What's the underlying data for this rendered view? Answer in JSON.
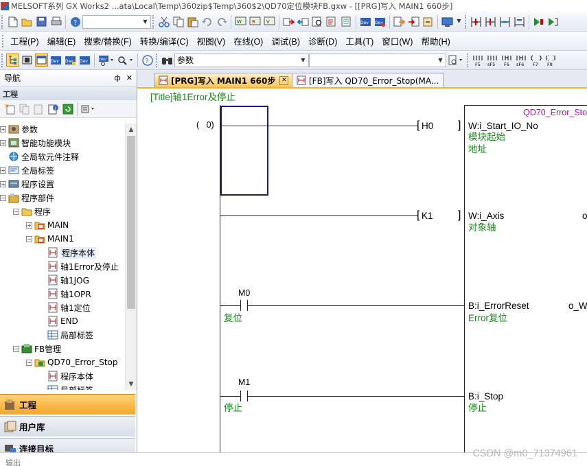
{
  "window": {
    "title": "MELSOFT系列 GX Works2 ...ata\\Local\\Temp\\360zip$Temp\\360$2\\QD70定位模块FB.gxw - [[PRG]写入 MAIN1 660步]"
  },
  "toolbar1": {
    "combo_value": "",
    "buttons": [
      "new-file-icon",
      "open-folder-icon",
      "save-icon",
      "print-icon",
      "help-icon",
      "cut-icon",
      "copy-icon",
      "paste-icon",
      "undo-icon",
      "redo-icon",
      "plc-write-icon",
      "plc-read-icon",
      "verify-icon",
      "monitor-icon",
      "device-test-icon",
      "write-arrow-icon",
      "read-arrow-icon",
      "search-device-icon",
      "cross-ref-icon",
      "device-batch-icon",
      "dev-icon",
      "dev-detail-icon",
      "export-icon",
      "import-icon",
      "link-icon",
      "display-icon",
      "ladder-insert-icon",
      "ladder-insert2-icon",
      "ladder-delete-icon",
      "ladder-delete2-icon",
      "step-run-icon",
      "step-run2-icon"
    ]
  },
  "menu": [
    "工程(P)",
    "编辑(E)",
    "搜索/替换(F)",
    "转换/编译(C)",
    "视图(V)",
    "在线(O)",
    "调试(B)",
    "诊断(D)",
    "工具(T)",
    "窗口(W)",
    "帮助(H)"
  ],
  "toolbar2": {
    "param_combo": "参数",
    "second_combo": "",
    "fkeys": [
      "F5",
      "sF5",
      "F6",
      "sF6",
      "F7",
      "F8"
    ]
  },
  "nav": {
    "title": "导航",
    "pin": "ф",
    "close": "✕",
    "section": "工程",
    "tree": [
      {
        "label": "参数",
        "depth": 0,
        "exp": "+",
        "icon": "param"
      },
      {
        "label": "智能功能模块",
        "depth": 0,
        "exp": "+",
        "icon": "module"
      },
      {
        "label": "全局软元件注释",
        "depth": 0,
        "exp": "",
        "icon": "globe"
      },
      {
        "label": "全局标签",
        "depth": 0,
        "exp": "+",
        "icon": "label"
      },
      {
        "label": "程序设置",
        "depth": 0,
        "exp": "+",
        "icon": "setting"
      },
      {
        "label": "程序部件",
        "depth": 0,
        "exp": "−",
        "icon": "parts"
      },
      {
        "label": "程序",
        "depth": 1,
        "exp": "−",
        "icon": "folder"
      },
      {
        "label": "MAIN",
        "depth": 2,
        "exp": "+",
        "icon": "prog"
      },
      {
        "label": "MAIN1",
        "depth": 2,
        "exp": "−",
        "icon": "prog"
      },
      {
        "label": "程序本体",
        "depth": 3,
        "exp": "",
        "icon": "doc",
        "selected": true
      },
      {
        "label": "轴1Error及停止",
        "depth": 3,
        "exp": "",
        "icon": "doc"
      },
      {
        "label": "轴1JOG",
        "depth": 3,
        "exp": "",
        "icon": "doc"
      },
      {
        "label": "轴1OPR",
        "depth": 3,
        "exp": "",
        "icon": "doc"
      },
      {
        "label": "轴1定位",
        "depth": 3,
        "exp": "",
        "icon": "doc"
      },
      {
        "label": "END",
        "depth": 3,
        "exp": "",
        "icon": "doc"
      },
      {
        "label": "局部标签",
        "depth": 3,
        "exp": "",
        "icon": "table"
      },
      {
        "label": "FB管理",
        "depth": 1,
        "exp": "−",
        "icon": "fb"
      },
      {
        "label": "QD70_Error_Stop",
        "depth": 2,
        "exp": "−",
        "icon": "fbfolder"
      },
      {
        "label": "程序本体",
        "depth": 3,
        "exp": "",
        "icon": "doc"
      },
      {
        "label": "局部标签",
        "depth": 3,
        "exp": "",
        "icon": "table"
      }
    ],
    "panes": [
      "工程",
      "用户库",
      "连接目标"
    ]
  },
  "tabs": [
    {
      "label": "[PRG]写入 MAIN1 660步",
      "active": true
    },
    {
      "label": "[FB]写入 QD70_Error_Stop(MA..."
    }
  ],
  "ladder": {
    "title_comment": "[Title]轴1Error及停止",
    "fb_name": "QD70_Error_Sto",
    "step": "(   0)",
    "inputs": [
      {
        "operand": "H0",
        "param": "W:i_Start_IO_No",
        "comment1": "模块起始",
        "comment2": "地址"
      },
      {
        "operand": "K1",
        "param": "W:i_Axis",
        "comment1": "对象轴",
        "right": "o"
      },
      {
        "device": "M0",
        "comment": "复位",
        "param": "B:i_ErrorReset",
        "comment1": "Error复位",
        "right": "o_W"
      },
      {
        "device": "M1",
        "comment": "停止",
        "param": "B:i_Stop",
        "comment1": "停止"
      }
    ]
  },
  "bottom": {
    "label": "输出"
  },
  "watermark": "CSDN @m0_71374961"
}
